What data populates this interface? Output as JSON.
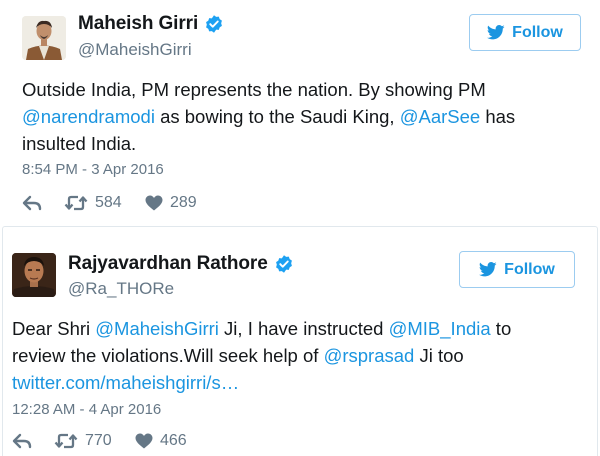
{
  "tweets": [
    {
      "display_name": "Maheish Girri",
      "handle": "@MaheishGirri",
      "follow_label": "Follow",
      "text_lines": [
        [
          {
            "t": "text",
            "v": "Outside India, PM represents the nation. By showing PM"
          }
        ],
        [
          {
            "t": "mention",
            "v": "@narendramodi"
          },
          {
            "t": "text",
            "v": " as bowing to the Saudi King, "
          },
          {
            "t": "mention",
            "v": "@AarSee"
          },
          {
            "t": "text",
            "v": " has"
          }
        ],
        [
          {
            "t": "text",
            "v": "insulted India."
          }
        ]
      ],
      "timestamp": "8:54 PM - 3 Apr 2016",
      "retweets": "584",
      "likes": "289"
    },
    {
      "display_name": "Rajyavardhan Rathore",
      "handle": "@Ra_THORe",
      "follow_label": "Follow",
      "text_lines": [
        [
          {
            "t": "text",
            "v": "Dear Shri "
          },
          {
            "t": "mention",
            "v": "@MaheishGirri"
          },
          {
            "t": "text",
            "v": " Ji, I have instructed "
          },
          {
            "t": "mention",
            "v": "@MIB_India"
          },
          {
            "t": "text",
            "v": " to"
          }
        ],
        [
          {
            "t": "text",
            "v": "review the violations.Will seek help of "
          },
          {
            "t": "mention",
            "v": "@rsprasad"
          },
          {
            "t": "text",
            "v": " Ji too"
          }
        ],
        [
          {
            "t": "link",
            "v": "twitter.com/maheishgirri/s…"
          }
        ]
      ],
      "timestamp": "12:28 AM - 4 Apr 2016",
      "retweets": "770",
      "likes": "466"
    }
  ],
  "icons": {
    "verified": "verified-badge-icon",
    "follow": "twitter-bird-icon",
    "reply": "reply-arrow-icon",
    "retweet": "retweet-icon",
    "like": "heart-icon"
  },
  "colors": {
    "link_blue": "#1b95e0",
    "verified_blue": "#1da1f2",
    "muted_gray": "#657786",
    "border": "#e1e8ed",
    "text": "#14171a"
  }
}
